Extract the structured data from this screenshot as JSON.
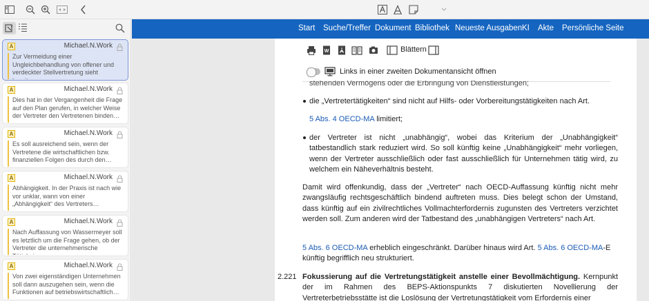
{
  "toolbar": {
    "icons": [
      "sidebar-toggle-icon",
      "zoom-out-icon",
      "zoom-in-icon",
      "fit-width-icon",
      "back-icon",
      "text-style-a-icon",
      "text-a-icon",
      "note-icon",
      "chevron-down-icon"
    ]
  },
  "sidebar": {
    "cards": [
      {
        "author": "Michael.N.Work",
        "excerpt": "Zur Vermeidung einer Ungleichbehandlung von offener und verdeckter Stellvertretung sieht bereits…",
        "active": true
      },
      {
        "author": "Michael.N.Work",
        "excerpt": "Dies hat in der Vergangenheit die Frage auf den Plan gerufen, in welcher Weise der Vertreter den Vertretenen binden…"
      },
      {
        "author": "Michael.N.Work",
        "excerpt": "Es soll ausreichend sein, wenn der Vertretene die wirtschaftlichen bzw. finanziellen Folgen des durch den…"
      },
      {
        "author": "Michael.N.Work",
        "excerpt": "Abhängigkeit. In der Praxis ist nach wie vor unklar, wann von einer „Abhängigkeit“ des Vertreters…"
      },
      {
        "author": "Michael.N.Work",
        "excerpt": "Nach Auffassung von Wassermeyer soll es letztlich um die Frage gehen, ob der Vertreter die unternehmerische Tätigkei…"
      },
      {
        "author": "Michael.N.Work",
        "excerpt": "Von zwei eigenständigen Unternehmen soll dann auszugehen sein, wenn die Funktionen auf betriebswirtschaftlich…"
      }
    ]
  },
  "nav": {
    "items": [
      "Start",
      "Suche/Treffer",
      "Dokument",
      "Bibliothek",
      "Neueste Ausgaben",
      "KI",
      "Akte",
      "Persönliche Seite"
    ]
  },
  "doctools": {
    "browse_label": "Blättern",
    "second_view_label": "Links in einer zweiten Dokumentansicht öffnen"
  },
  "document": {
    "cutoff_line": "stehenden Vermögens oder die Erbringung von Dienstleistungen;",
    "bullet1": "die „Vertretertätigkeiten“ sind nicht auf Hilfs- oder Vorbereitungstätigkeiten nach Art.",
    "bullet1_link": "5 Abs. 4 OECD-MA",
    "bullet1_tail": " limitiert;",
    "bullet2": "der Vertreter ist nicht „unabhängig“, wobei das Kriterium der „Unabhängigkeit“ tatbestandlich stark reduziert wird. So soll künftig keine „Unabhängigkeit“ mehr vorliegen, wenn der Vertreter ausschließlich oder fast ausschließlich für Unternehmen tätig wird, zu welchem ein Näheverhältnis besteht.",
    "para1": "Damit wird offenkundig, dass der „Vertreter“ nach OECD-Auffassung künftig nicht mehr zwangsläufig rechtsgeschäftlich bindend auftreten muss. Dies belegt schon der Umstand, dass künftig auf ein zivilrechtliches Vollmachterfordernis zugunsten des Vertreters verzichtet werden soll. Zum anderen wird der Tatbestand des „unabhängigen Vertreters“ nach Art.",
    "para2_link1": "5 Abs. 6 OECD-MA",
    "para2_mid": " erheblich eingeschränkt. Darüber hinaus wird Art. ",
    "para2_link2": "5 Abs. 6 OECD-MA",
    "para2_tail": "-E künftig begrifflich neu strukturiert.",
    "section_number": "2.221",
    "section_bold": "Fokussierung auf die Vertretungstätigkeit anstelle einer Bevollmächtigung.",
    "section_text": " Kernpunkt der im Rahmen des BEPS-Aktionspunkts 7 diskutierten Novellierung der Vertreterbetriebsstätte ist die Loslösung der Vertretungstätigkeit vom Erfordernis einer"
  },
  "colors": {
    "nav_bg": "#1565c0",
    "link": "#1a5bb5",
    "highlight": "#f0c040",
    "active_card": "#dde4f5"
  }
}
